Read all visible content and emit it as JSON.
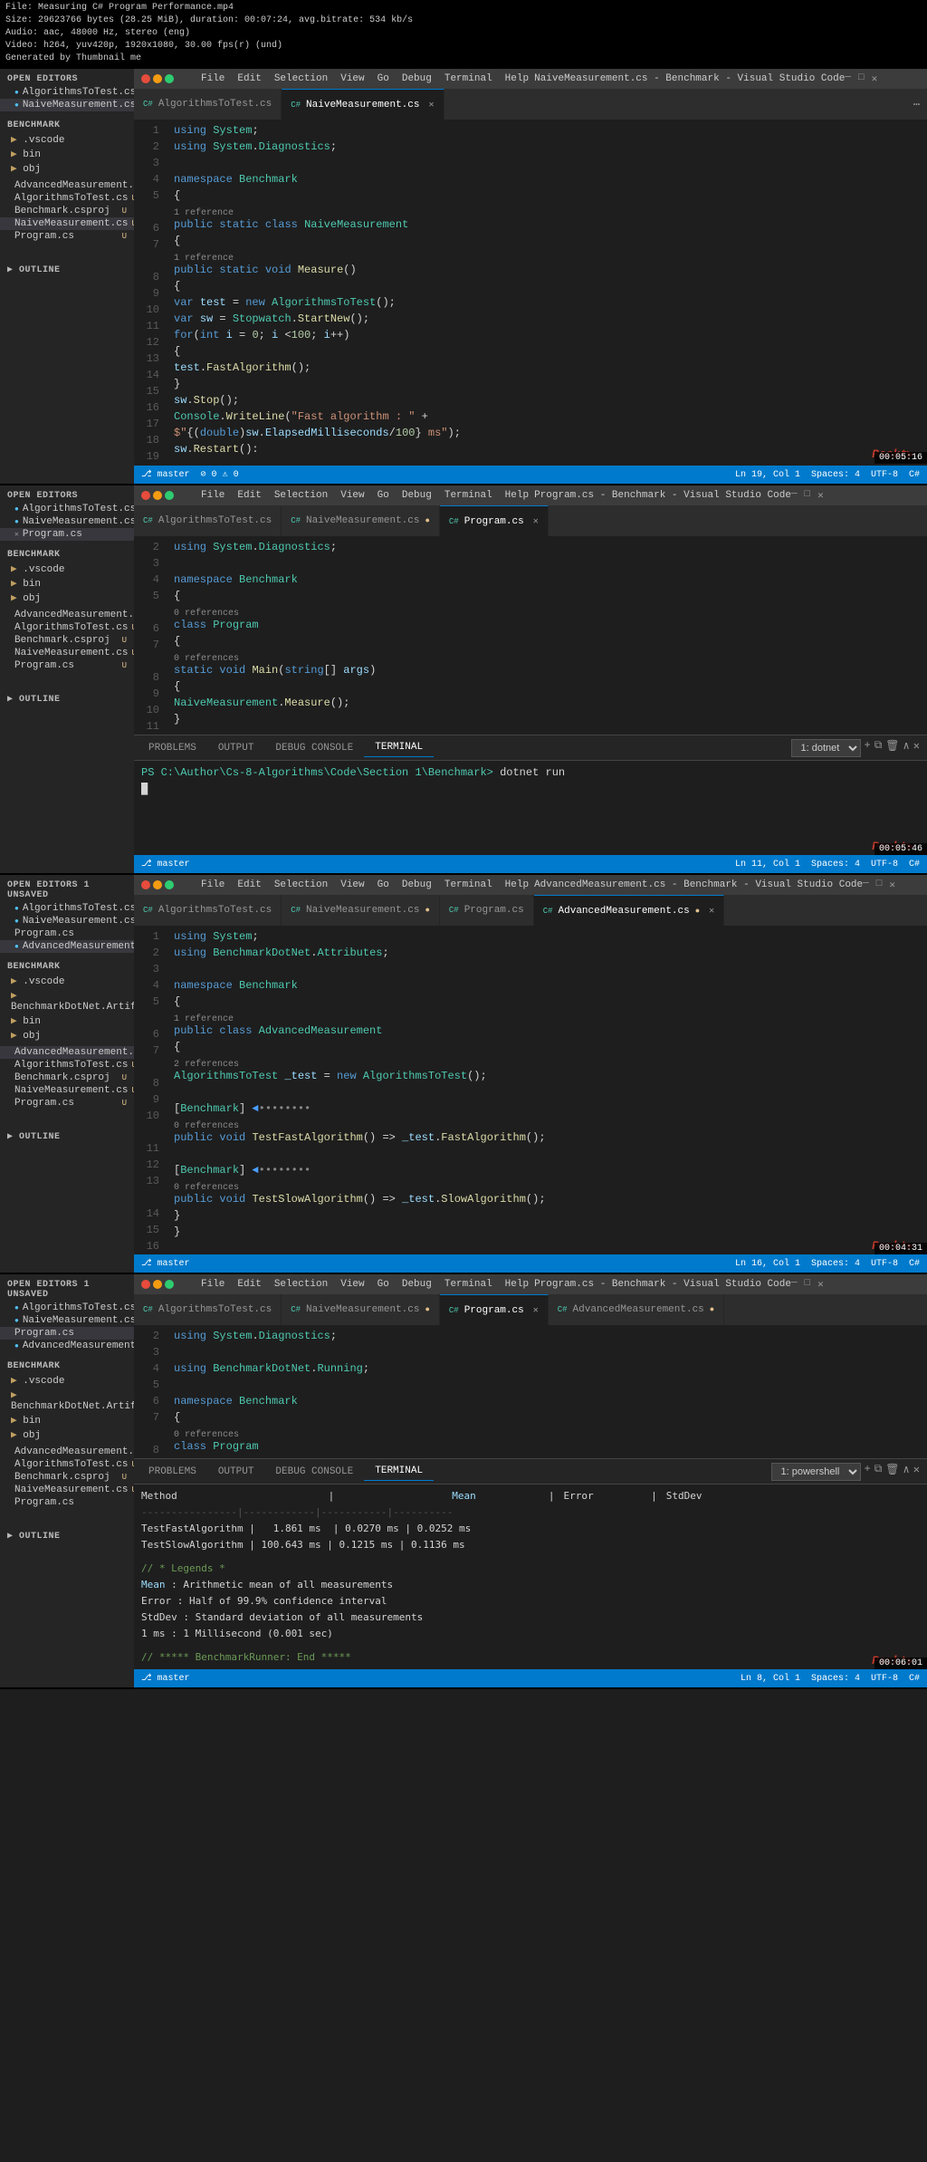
{
  "video_info": {
    "title": "File: Measuring C# Program Performance.mp4",
    "size": "Size: 29623766 bytes (28.25 MiB), duration: 00:07:24, avg.bitrate: 534 kb/s",
    "audio": "Audio: aac, 48000 Hz, stereo (eng)",
    "video": "Video: h264, yuv420p, 1920x1080, 30.00 fps(r) (und)",
    "generated": "Generated by Thumbnail me"
  },
  "section1": {
    "window_title": "NaiveMeasurement.cs - Benchmark - Visual Studio Code",
    "timestamp": "00:05:16",
    "tabs": [
      "AlgorithmsToTest.cs",
      "NaiveMeasurement.cs ×"
    ],
    "active_tab": "NaiveMeasurement.cs",
    "menu": [
      "File",
      "Edit",
      "Selection",
      "View",
      "Go",
      "Debug",
      "Terminal",
      "Help"
    ],
    "sidebar": {
      "open_editors_title": "OPEN EDITORS",
      "items_open": [
        "AlgorithmsToTest.cs  U",
        "NaiveMeasurement.cs  U"
      ],
      "benchmark_title": "BENCHMARK",
      "folders": [
        ".vscode",
        "bin",
        "obj"
      ],
      "files": [
        "AdvancedMeasurement.cs  U",
        "AlgorithmsToTest.cs  U",
        "Benchmark.csproj  U",
        "NaiveMeasurement.cs  U",
        "Program.cs  U"
      ]
    },
    "code_lines": [
      {
        "num": "1",
        "code": "using System;"
      },
      {
        "num": "2",
        "code": "using System.Diagnostics;"
      },
      {
        "num": "3",
        "code": ""
      },
      {
        "num": "4",
        "code": "namespace Benchmark"
      },
      {
        "num": "5",
        "code": "{"
      },
      {
        "num": "",
        "code": "    1 reference"
      },
      {
        "num": "6",
        "code": "    public static class NaiveMeasurement"
      },
      {
        "num": "7",
        "code": "    {"
      },
      {
        "num": "",
        "code": "        1 reference"
      },
      {
        "num": "8",
        "code": "        public static void Measure()"
      },
      {
        "num": "9",
        "code": "        {"
      },
      {
        "num": "10",
        "code": "            var test = new AlgorithmsToTest();"
      },
      {
        "num": "11",
        "code": "            var sw = Stopwatch.StartNew();"
      },
      {
        "num": "12",
        "code": "            for(int i = 0; i <100; i++)"
      },
      {
        "num": "13",
        "code": "            {"
      },
      {
        "num": "14",
        "code": "                test.FastAlgorithm();"
      },
      {
        "num": "15",
        "code": "            }"
      },
      {
        "num": "16",
        "code": "            sw.Stop();"
      },
      {
        "num": "17",
        "code": "            Console.WriteLine(\"Fast algorithm : \" +"
      },
      {
        "num": "18",
        "code": "                $\"{(double)sw.ElapsedMilliseconds/100} ms\");"
      },
      {
        "num": "19",
        "code": "            sw.Restart():"
      }
    ]
  },
  "section2": {
    "window_title": "Program.cs - Benchmark - Visual Studio Code",
    "timestamp": "00:05:46",
    "tabs": [
      "AlgorithmsToTest.cs",
      "NaiveMeasurement.cs ●",
      "Program.cs ×"
    ],
    "active_tab": "Program.cs",
    "menu": [
      "File",
      "Edit",
      "Selection",
      "View",
      "Go",
      "Debug",
      "Terminal",
      "Help"
    ],
    "sidebar": {
      "open_editors_title": "OPEN EDITORS",
      "items_open": [
        "AlgorithmsToTest.cs  U",
        "NaiveMeasurement.cs  U",
        "Program.cs"
      ],
      "benchmark_title": "BENCHMARK",
      "folders": [
        ".vscode",
        "bin",
        "obj"
      ],
      "files": [
        "AdvancedMeasurement.cs  U",
        "AlgorithmsToTest.cs  U",
        "Benchmark.csproj  U",
        "NaiveMeasurement.cs  U",
        "Program.cs  U"
      ]
    },
    "code_lines": [
      {
        "num": "2",
        "code": "using System.Diagnostics;"
      },
      {
        "num": "3",
        "code": ""
      },
      {
        "num": "4",
        "code": "namespace Benchmark"
      },
      {
        "num": "5",
        "code": "{"
      },
      {
        "num": "",
        "code": "    0 references"
      },
      {
        "num": "6",
        "code": "    class Program"
      },
      {
        "num": "7",
        "code": "    {"
      },
      {
        "num": "",
        "code": "        0 references"
      },
      {
        "num": "8",
        "code": "        static void Main(string[] args)"
      },
      {
        "num": "9",
        "code": "        {"
      },
      {
        "num": "10",
        "code": "            NaiveMeasurement.Measure();"
      },
      {
        "num": "11",
        "code": "        }"
      }
    ],
    "terminal": {
      "label": "TERMINAL",
      "tabs": [
        "PROBLEMS",
        "OUTPUT",
        "DEBUG CONSOLE",
        "TERMINAL"
      ],
      "dropdown": "1: dotnet",
      "content": "PS C:\\Author\\Cs-8-Algorithms\\Code\\Section 1\\Benchmark> dotnet run",
      "cursor": true
    }
  },
  "section3": {
    "window_title": "AdvancedMeasurement.cs - Benchmark - Visual Studio Code",
    "timestamp": "00:04:31",
    "tabs": [
      "AlgorithmsToTest.cs",
      "NaiveMeasurement.cs ●",
      "Program.cs",
      "AdvancedMeasurement.cs ×"
    ],
    "active_tab": "AdvancedMeasurement.cs",
    "menu": [
      "File",
      "Edit",
      "Selection",
      "View",
      "Go",
      "Debug",
      "Terminal",
      "Help"
    ],
    "sidebar": {
      "open_editors_title": "OPEN EDITORS  1 UNSAVED",
      "items_open": [
        "AlgorithmsToTest.cs  U",
        "NaiveMeasurement.cs  U",
        "Program.cs",
        "AdvancedMeasurement.cs  U"
      ],
      "benchmark_title": "BENCHMARK",
      "folders": [
        ".vscode",
        "BenchmarkDotNet.Artifacts",
        "bin",
        "obj"
      ],
      "files": [
        "AdvancedMeasurement.cs  U",
        "AlgorithmsToTest.cs  U",
        "Benchmark.csproj  U",
        "NaiveMeasurement.cs  U",
        "Program.cs  U"
      ]
    },
    "code_lines": [
      {
        "num": "1",
        "code": "using System;"
      },
      {
        "num": "2",
        "code": "using BenchmarkDotNet.Attributes;"
      },
      {
        "num": "3",
        "code": ""
      },
      {
        "num": "4",
        "code": "namespace Benchmark"
      },
      {
        "num": "5",
        "code": "{"
      },
      {
        "num": "",
        "code": "    1 reference"
      },
      {
        "num": "6",
        "code": "    public class AdvancedMeasurement"
      },
      {
        "num": "7",
        "code": "    {"
      },
      {
        "num": "",
        "code": "        2 references"
      },
      {
        "num": "8",
        "code": "        AlgorithmsToTest _test = new AlgorithmsToTest();"
      },
      {
        "num": "9",
        "code": ""
      },
      {
        "num": "10",
        "code": "        [Benchmark]  ◄••••••••"
      },
      {
        "num": "",
        "code": "        0 references"
      },
      {
        "num": "11",
        "code": "        public void TestFastAlgorithm() => _test.FastAlgorithm();"
      },
      {
        "num": "12",
        "code": ""
      },
      {
        "num": "13",
        "code": "        [Benchmark]  ◄••••••••"
      },
      {
        "num": "",
        "code": "        0 references"
      },
      {
        "num": "14",
        "code": "        public void TestSlowAlgorithm() => _test.SlowAlgorithm();"
      },
      {
        "num": "15",
        "code": "    }"
      },
      {
        "num": "16",
        "code": "}"
      }
    ]
  },
  "section4": {
    "window_title": "Program.cs - Benchmark - Visual Studio Code",
    "timestamp": "00:06:01",
    "tabs": [
      "AlgorithmsToTest.cs",
      "NaiveMeasurement.cs ●",
      "Program.cs ×",
      "AdvancedMeasurement.cs ●"
    ],
    "active_tab": "Program.cs",
    "menu": [
      "File",
      "Edit",
      "Selection",
      "View",
      "Go",
      "Debug",
      "Terminal",
      "Help"
    ],
    "sidebar": {
      "open_editors_title": "OPEN EDITORS  1 UNSAVED",
      "items_open": [
        "AlgorithmsToTest.cs  U",
        "NaiveMeasurement.cs  U",
        "Program.cs",
        "AdvancedMeasurement.cs  U"
      ],
      "benchmark_title": "BENCHMARK",
      "folders": [
        ".vscode",
        "BenchmarkDotNet.Artifacts",
        "bin",
        "obj"
      ],
      "files": [
        "AdvancedMeasurement.cs  U",
        "AlgorithmsToTest.cs  U",
        "Benchmark.csproj  U",
        "NaiveMeasurement.cs  U",
        "Program.cs"
      ]
    },
    "code_lines": [
      {
        "num": "2",
        "code": "using System.Diagnostics;"
      },
      {
        "num": "3",
        "code": ""
      },
      {
        "num": "4",
        "code": "using BenchmarkDotNet.Running;"
      },
      {
        "num": "5",
        "code": ""
      },
      {
        "num": "6",
        "code": "namespace Benchmark"
      },
      {
        "num": "7",
        "code": "{"
      },
      {
        "num": "",
        "code": "    0 references"
      },
      {
        "num": "8",
        "code": "    class Program"
      }
    ],
    "terminal": {
      "label": "TERMINAL",
      "tabs": [
        "PROBLEMS",
        "OUTPUT",
        "DEBUG CONSOLE",
        "TERMINAL"
      ],
      "dropdown": "1: powershell",
      "table_header": "Method         |    Mean    |   Error   |  StdDev",
      "table_sep": "---------------|------------|-----------|--------",
      "table_rows": [
        "TestFastAlgorithm |  1.861 ms  |  0.0270 ms  |  0.0252 ms",
        "TestSlowAlgorithm | 100.643 ms |  0.1215 ms  |  0.1136 ms"
      ],
      "legend_header": "// * Legends *",
      "legends": [
        "Mean  : Arithmetic mean of all measurements",
        "Error : Half of 99.9% confidence interval",
        "StdDev: Standard deviation of all measurements",
        "1 ms  : 1 Millisecond (0.001 sec)"
      ],
      "footer": "// ***** BenchmarkRunner: End *****"
    },
    "mean_label": "Mean",
    "mean_label2": "Mean"
  },
  "outline_label": "OUTLINE",
  "colors": {
    "accent": "#007acc",
    "background": "#1e1e1e",
    "sidebar_bg": "#252526",
    "tab_active": "#1e1e1e",
    "keyword": "#569cd6",
    "type": "#4ec9b0",
    "string": "#ce9178",
    "number": "#b5cea8",
    "comment": "#6a9955",
    "method": "#dcdcaa",
    "property": "#9cdcfe"
  }
}
